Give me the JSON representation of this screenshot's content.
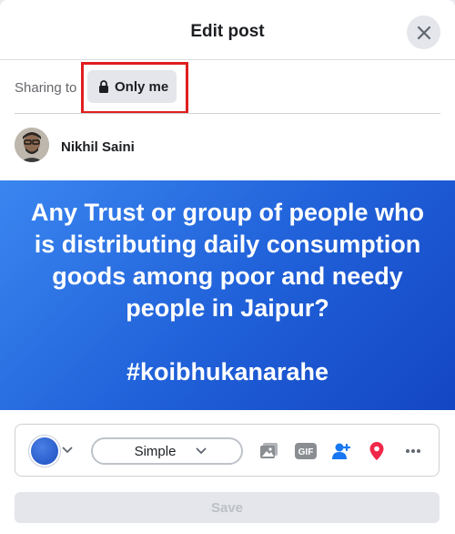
{
  "dialog": {
    "title": "Edit post"
  },
  "sharing": {
    "label": "Sharing to",
    "privacy": "Only me"
  },
  "author": {
    "name": "Nikhil Saini"
  },
  "post": {
    "text": "Any Trust or group of people who is distributing daily consumption goods among poor and needy people in Jaipur?\n\n#koibhukanarahe",
    "background_color": "#2563d9"
  },
  "toolbar": {
    "font_style": "Simple",
    "icons": [
      "color-picker",
      "photo-icon",
      "gif-icon",
      "tag-people-icon",
      "location-pin-icon",
      "more-icon"
    ],
    "accent_colors": {
      "tag_people": "#1877f2",
      "location": "#f02849",
      "gif": "#8a8d91"
    }
  },
  "save": {
    "label": "Save",
    "enabled": false
  }
}
